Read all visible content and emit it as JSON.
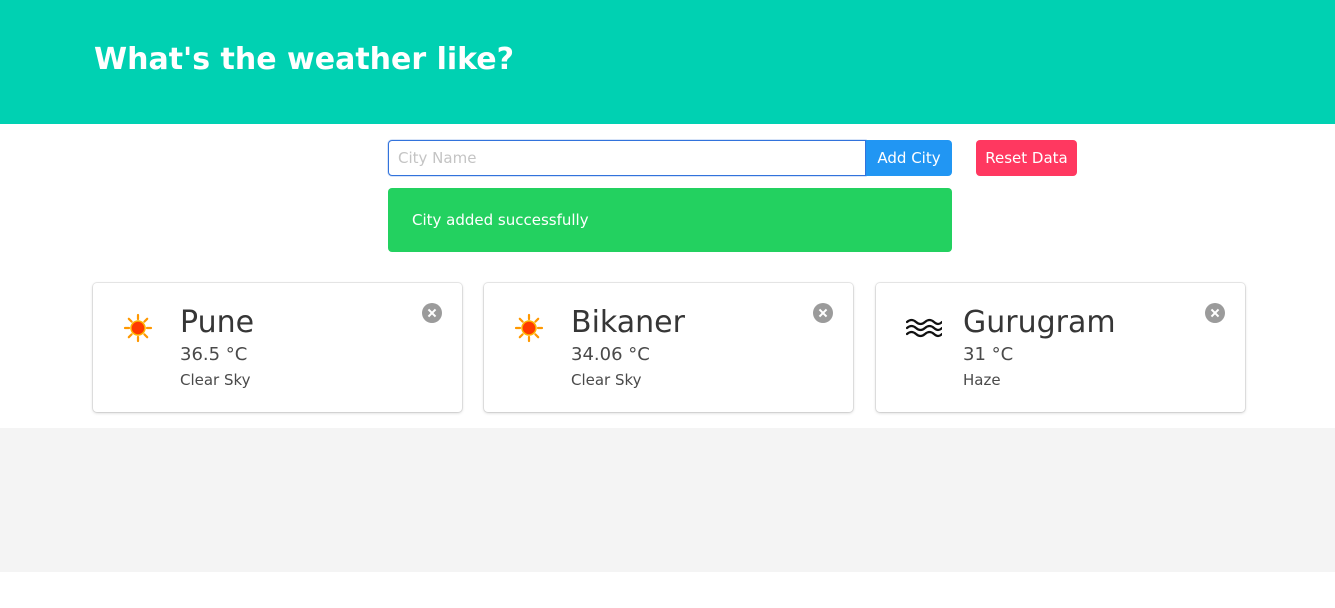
{
  "header": {
    "title": "What's the weather like?",
    "background": "#00d1b2"
  },
  "form": {
    "city_input_value": "",
    "city_input_placeholder": "City Name",
    "add_button_label": "Add City",
    "reset_button_label": "Reset Data"
  },
  "notification": {
    "message": "City added successfully",
    "color": "#23d160"
  },
  "cities": [
    {
      "name": "Pune",
      "temperature": "36.5 °C",
      "description": "Clear Sky",
      "icon": "sun-icon"
    },
    {
      "name": "Bikaner",
      "temperature": "34.06 °C",
      "description": "Clear Sky",
      "icon": "sun-icon"
    },
    {
      "name": "Gurugram",
      "temperature": "31 °C",
      "description": "Haze",
      "icon": "haze-icon"
    }
  ],
  "colors": {
    "add_button": "#2196f3",
    "reset_button": "#ff3860",
    "delete_button": "#9b9b9b"
  }
}
